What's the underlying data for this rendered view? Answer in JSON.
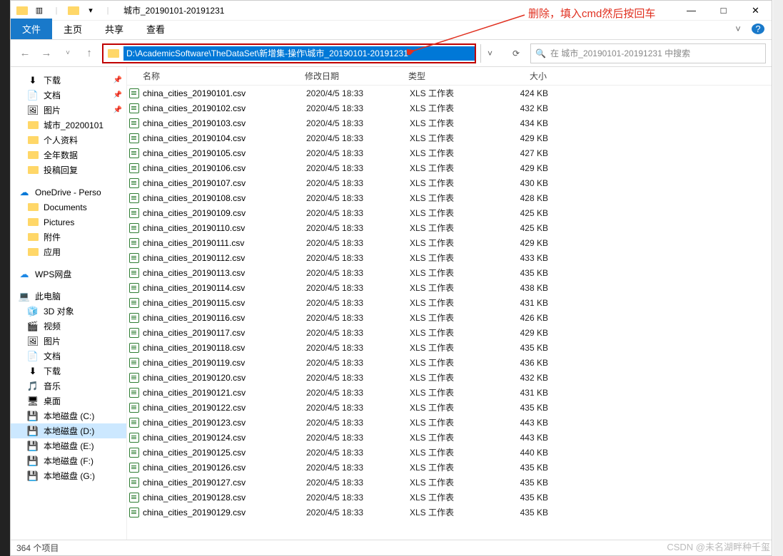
{
  "window": {
    "title": "城市_20190101-20191231",
    "min": "—",
    "max": "□",
    "close": "✕"
  },
  "ribbon": {
    "file": "文件",
    "home": "主页",
    "share": "共享",
    "view": "查看",
    "expand_tip": "˅",
    "help": "?"
  },
  "nav": {
    "back": "←",
    "forward": "→",
    "up": "↑",
    "recent": "˅",
    "path": "D:\\AcademicSoftware\\TheDataSet\\新增集-操作\\城市_20190101-20191231",
    "drop": "˅",
    "refresh": "⟳"
  },
  "search": {
    "icon": "🔍",
    "placeholder": "在 城市_20190101-20191231 中搜索"
  },
  "sidebar": {
    "quick": [
      {
        "icon": "⬇",
        "label": "下载",
        "pinned": true
      },
      {
        "icon": "📄",
        "label": "文档",
        "pinned": true
      },
      {
        "icon": "🖼",
        "label": "图片",
        "pinned": true
      },
      {
        "icon": "folder",
        "label": "城市_20200101"
      },
      {
        "icon": "folder",
        "label": "个人资料"
      },
      {
        "icon": "folder",
        "label": "全年数据"
      },
      {
        "icon": "folder",
        "label": "投稿回复"
      }
    ],
    "onedrive": {
      "icon": "☁",
      "label": "OneDrive - Perso"
    },
    "od_items": [
      {
        "icon": "folder",
        "label": "Documents"
      },
      {
        "icon": "folder",
        "label": "Pictures"
      },
      {
        "icon": "folder",
        "label": "附件"
      },
      {
        "icon": "folder",
        "label": "应用"
      }
    ],
    "wps": {
      "icon": "☁",
      "label": "WPS网盘",
      "color": "#1e88e5"
    },
    "thispc": {
      "icon": "💻",
      "label": "此电脑"
    },
    "pc_items": [
      {
        "icon": "🧊",
        "label": "3D 对象"
      },
      {
        "icon": "🎬",
        "label": "视频"
      },
      {
        "icon": "🖼",
        "label": "图片"
      },
      {
        "icon": "📄",
        "label": "文档"
      },
      {
        "icon": "⬇",
        "label": "下载"
      },
      {
        "icon": "🎵",
        "label": "音乐"
      },
      {
        "icon": "🖥",
        "label": "桌面"
      },
      {
        "icon": "💾",
        "label": "本地磁盘 (C:)"
      },
      {
        "icon": "💾",
        "label": "本地磁盘 (D:)",
        "selected": true
      },
      {
        "icon": "💾",
        "label": "本地磁盘 (E:)"
      },
      {
        "icon": "💾",
        "label": "本地磁盘 (F:)"
      },
      {
        "icon": "💾",
        "label": "本地磁盘 (G:)"
      }
    ]
  },
  "columns": {
    "name": "名称",
    "date": "修改日期",
    "type": "类型",
    "size": "大小"
  },
  "file_type": "XLS 工作表",
  "file_date": "2020/4/5 18:33",
  "files": [
    {
      "name": "china_cities_20190101.csv",
      "size": "424 KB"
    },
    {
      "name": "china_cities_20190102.csv",
      "size": "432 KB"
    },
    {
      "name": "china_cities_20190103.csv",
      "size": "434 KB"
    },
    {
      "name": "china_cities_20190104.csv",
      "size": "429 KB"
    },
    {
      "name": "china_cities_20190105.csv",
      "size": "427 KB"
    },
    {
      "name": "china_cities_20190106.csv",
      "size": "429 KB"
    },
    {
      "name": "china_cities_20190107.csv",
      "size": "430 KB"
    },
    {
      "name": "china_cities_20190108.csv",
      "size": "428 KB"
    },
    {
      "name": "china_cities_20190109.csv",
      "size": "425 KB"
    },
    {
      "name": "china_cities_20190110.csv",
      "size": "425 KB"
    },
    {
      "name": "china_cities_20190111.csv",
      "size": "429 KB"
    },
    {
      "name": "china_cities_20190112.csv",
      "size": "433 KB"
    },
    {
      "name": "china_cities_20190113.csv",
      "size": "435 KB"
    },
    {
      "name": "china_cities_20190114.csv",
      "size": "438 KB"
    },
    {
      "name": "china_cities_20190115.csv",
      "size": "431 KB"
    },
    {
      "name": "china_cities_20190116.csv",
      "size": "426 KB"
    },
    {
      "name": "china_cities_20190117.csv",
      "size": "429 KB"
    },
    {
      "name": "china_cities_20190118.csv",
      "size": "435 KB"
    },
    {
      "name": "china_cities_20190119.csv",
      "size": "436 KB"
    },
    {
      "name": "china_cities_20190120.csv",
      "size": "432 KB"
    },
    {
      "name": "china_cities_20190121.csv",
      "size": "431 KB"
    },
    {
      "name": "china_cities_20190122.csv",
      "size": "435 KB"
    },
    {
      "name": "china_cities_20190123.csv",
      "size": "443 KB"
    },
    {
      "name": "china_cities_20190124.csv",
      "size": "443 KB"
    },
    {
      "name": "china_cities_20190125.csv",
      "size": "440 KB"
    },
    {
      "name": "china_cities_20190126.csv",
      "size": "435 KB"
    },
    {
      "name": "china_cities_20190127.csv",
      "size": "435 KB"
    },
    {
      "name": "china_cities_20190128.csv",
      "size": "435 KB"
    },
    {
      "name": "china_cities_20190129.csv",
      "size": "435 KB"
    }
  ],
  "status": {
    "count": "364 个项目"
  },
  "annotation": "删除，填入cmd然后按回车",
  "watermark": "CSDN @未名湖畔种千玺"
}
